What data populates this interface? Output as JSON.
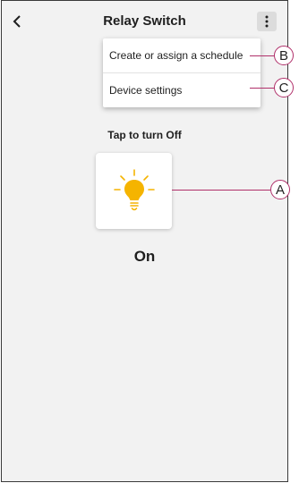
{
  "header": {
    "title": "Relay Switch",
    "back_icon": "chevron-left-icon",
    "more_icon": "more-vertical-icon"
  },
  "menu": {
    "items": [
      {
        "label": "Create or assign a schedule"
      },
      {
        "label": "Device settings"
      }
    ]
  },
  "control": {
    "hint": "Tap to turn Off",
    "state": "On",
    "icon": "lightbulb-icon",
    "bulb_color": "#f5b400"
  },
  "callouts": {
    "a": "A",
    "b": "B",
    "c": "C",
    "color": "#b0306a"
  }
}
